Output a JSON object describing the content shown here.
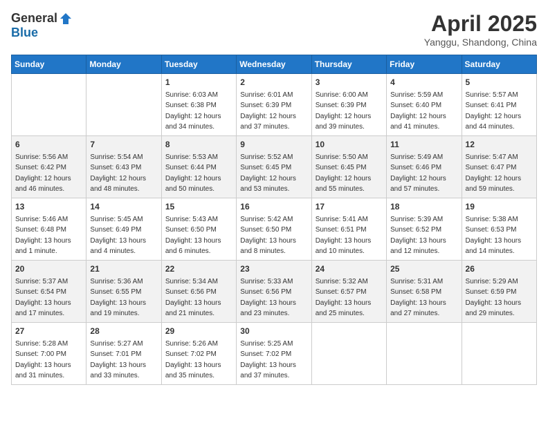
{
  "header": {
    "logo_general": "General",
    "logo_blue": "Blue",
    "month": "April 2025",
    "location": "Yanggu, Shandong, China"
  },
  "weekdays": [
    "Sunday",
    "Monday",
    "Tuesday",
    "Wednesday",
    "Thursday",
    "Friday",
    "Saturday"
  ],
  "weeks": [
    [
      {
        "day": "",
        "info": ""
      },
      {
        "day": "",
        "info": ""
      },
      {
        "day": "1",
        "info": "Sunrise: 6:03 AM\nSunset: 6:38 PM\nDaylight: 12 hours\nand 34 minutes."
      },
      {
        "day": "2",
        "info": "Sunrise: 6:01 AM\nSunset: 6:39 PM\nDaylight: 12 hours\nand 37 minutes."
      },
      {
        "day": "3",
        "info": "Sunrise: 6:00 AM\nSunset: 6:39 PM\nDaylight: 12 hours\nand 39 minutes."
      },
      {
        "day": "4",
        "info": "Sunrise: 5:59 AM\nSunset: 6:40 PM\nDaylight: 12 hours\nand 41 minutes."
      },
      {
        "day": "5",
        "info": "Sunrise: 5:57 AM\nSunset: 6:41 PM\nDaylight: 12 hours\nand 44 minutes."
      }
    ],
    [
      {
        "day": "6",
        "info": "Sunrise: 5:56 AM\nSunset: 6:42 PM\nDaylight: 12 hours\nand 46 minutes."
      },
      {
        "day": "7",
        "info": "Sunrise: 5:54 AM\nSunset: 6:43 PM\nDaylight: 12 hours\nand 48 minutes."
      },
      {
        "day": "8",
        "info": "Sunrise: 5:53 AM\nSunset: 6:44 PM\nDaylight: 12 hours\nand 50 minutes."
      },
      {
        "day": "9",
        "info": "Sunrise: 5:52 AM\nSunset: 6:45 PM\nDaylight: 12 hours\nand 53 minutes."
      },
      {
        "day": "10",
        "info": "Sunrise: 5:50 AM\nSunset: 6:45 PM\nDaylight: 12 hours\nand 55 minutes."
      },
      {
        "day": "11",
        "info": "Sunrise: 5:49 AM\nSunset: 6:46 PM\nDaylight: 12 hours\nand 57 minutes."
      },
      {
        "day": "12",
        "info": "Sunrise: 5:47 AM\nSunset: 6:47 PM\nDaylight: 12 hours\nand 59 minutes."
      }
    ],
    [
      {
        "day": "13",
        "info": "Sunrise: 5:46 AM\nSunset: 6:48 PM\nDaylight: 13 hours\nand 1 minute."
      },
      {
        "day": "14",
        "info": "Sunrise: 5:45 AM\nSunset: 6:49 PM\nDaylight: 13 hours\nand 4 minutes."
      },
      {
        "day": "15",
        "info": "Sunrise: 5:43 AM\nSunset: 6:50 PM\nDaylight: 13 hours\nand 6 minutes."
      },
      {
        "day": "16",
        "info": "Sunrise: 5:42 AM\nSunset: 6:50 PM\nDaylight: 13 hours\nand 8 minutes."
      },
      {
        "day": "17",
        "info": "Sunrise: 5:41 AM\nSunset: 6:51 PM\nDaylight: 13 hours\nand 10 minutes."
      },
      {
        "day": "18",
        "info": "Sunrise: 5:39 AM\nSunset: 6:52 PM\nDaylight: 13 hours\nand 12 minutes."
      },
      {
        "day": "19",
        "info": "Sunrise: 5:38 AM\nSunset: 6:53 PM\nDaylight: 13 hours\nand 14 minutes."
      }
    ],
    [
      {
        "day": "20",
        "info": "Sunrise: 5:37 AM\nSunset: 6:54 PM\nDaylight: 13 hours\nand 17 minutes."
      },
      {
        "day": "21",
        "info": "Sunrise: 5:36 AM\nSunset: 6:55 PM\nDaylight: 13 hours\nand 19 minutes."
      },
      {
        "day": "22",
        "info": "Sunrise: 5:34 AM\nSunset: 6:56 PM\nDaylight: 13 hours\nand 21 minutes."
      },
      {
        "day": "23",
        "info": "Sunrise: 5:33 AM\nSunset: 6:56 PM\nDaylight: 13 hours\nand 23 minutes."
      },
      {
        "day": "24",
        "info": "Sunrise: 5:32 AM\nSunset: 6:57 PM\nDaylight: 13 hours\nand 25 minutes."
      },
      {
        "day": "25",
        "info": "Sunrise: 5:31 AM\nSunset: 6:58 PM\nDaylight: 13 hours\nand 27 minutes."
      },
      {
        "day": "26",
        "info": "Sunrise: 5:29 AM\nSunset: 6:59 PM\nDaylight: 13 hours\nand 29 minutes."
      }
    ],
    [
      {
        "day": "27",
        "info": "Sunrise: 5:28 AM\nSunset: 7:00 PM\nDaylight: 13 hours\nand 31 minutes."
      },
      {
        "day": "28",
        "info": "Sunrise: 5:27 AM\nSunset: 7:01 PM\nDaylight: 13 hours\nand 33 minutes."
      },
      {
        "day": "29",
        "info": "Sunrise: 5:26 AM\nSunset: 7:02 PM\nDaylight: 13 hours\nand 35 minutes."
      },
      {
        "day": "30",
        "info": "Sunrise: 5:25 AM\nSunset: 7:02 PM\nDaylight: 13 hours\nand 37 minutes."
      },
      {
        "day": "",
        "info": ""
      },
      {
        "day": "",
        "info": ""
      },
      {
        "day": "",
        "info": ""
      }
    ]
  ]
}
